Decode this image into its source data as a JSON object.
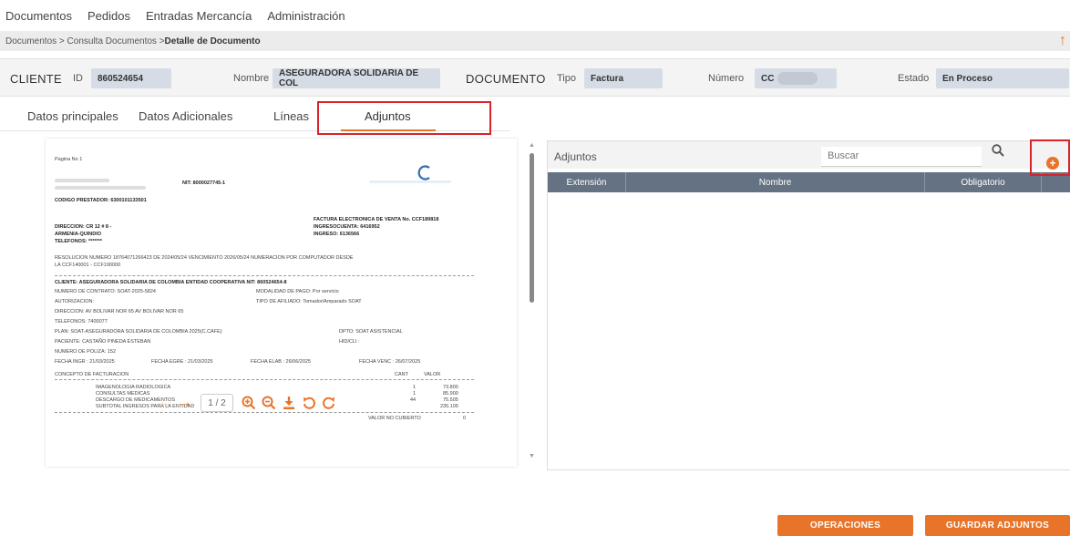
{
  "topnav": {
    "items": [
      "Documentos",
      "Pedidos",
      "Entradas Mercancía",
      "Administración"
    ]
  },
  "breadcrumb": {
    "trail": "Documentos > Consulta Documentos > ",
    "current": "Detalle de Documento"
  },
  "header": {
    "cliente_label": "CLIENTE",
    "id_label": "ID",
    "id_value": "860524654",
    "nombre_label": "Nombre",
    "nombre_value": "ASEGURADORA SOLIDARIA DE COL",
    "documento_label": "DOCUMENTO",
    "tipo_label": "Tipo",
    "tipo_value": "Factura",
    "numero_label": "Número",
    "numero_value": "CC",
    "estado_label": "Estado",
    "estado_value": "En Proceso"
  },
  "tabs": [
    "Datos principales",
    "Datos Adicionales",
    "Líneas",
    "Adjuntos"
  ],
  "active_tab": "Adjuntos",
  "document_preview": {
    "page_label": "Pagina No 1",
    "nit": "NIT: 8000027745-1",
    "codigo_prestador": "CODIGO PRESTADOR: 6300101133501",
    "factura": "FACTURA ELECTRONICA DE VENTA No. CCF189818",
    "ingreso_cuenta": "INGRESOCUENTA: 6416952",
    "ingreso": "INGRESO: 6136566",
    "direccion": "DIRECCION: CR 12 # 8 -",
    "ciudad": "ARMENIA-QUINDIO",
    "telefono": "TELEFONOS: *******",
    "resolucion": "RESOLUCION NUMERO 18764071266423 DE 2024/05/24 VENCIMIENTO 2026/05/24 NUMERACION POR COMPUTADOR DESDE",
    "rango": "LA CCF140001 - CCF190000",
    "cliente": "CLIENTE: ASEGURADORA SOLIDARIA DE COLOMBIA ENTIDAD COOPERATIVA NIT: 860524654-8",
    "contrato": "NUMERO DE CONTRATO: SOAT-2025-5824",
    "modalidad": "MODALIDAD DE PAGO: Por servicio",
    "autorizacion": "AUTORIZACION:",
    "tipo_afiliado": "TIPO DE AFILIADO: Tomador/Amparado SOAT",
    "direccion_cliente": "DIRECCION: AV BOLIVAR NOR 65 AV BOLIVAR NOR 65",
    "telefonos_cliente": "TELEFONOS: 7400077",
    "plan": "PLAN: SOAT-ASEGURADORA SOLIDARIA DE COLOMBIA 2025(C.CAFE)",
    "dpto": "DPTO: SOAT ASISTENCIAL",
    "paciente": "PACIENTE: CASTAÑO PINEDA ESTEBAN",
    "hid": "HID/CLI :",
    "poliza": "NUMERO DE POLIZA: 152",
    "fecha_ingr": "FECHA INGR : 21/03/2025",
    "fecha_egre": "FECHA EGRE : 21/03/2025",
    "fecha_elab": "FECHA ELAB : 26/06/2025",
    "fecha_venc": "FECHA VENC : 26/07/2025",
    "concepto_header": "CONCEPTO DE FACTURACION",
    "cant_header": "CANT",
    "valor_header": "VALOR",
    "lines": [
      {
        "concepto": "IMAGENOLOGIA RADIOLOGICA",
        "cant": "1",
        "valor": "73.800"
      },
      {
        "concepto": "CONSULTAS MEDICAS",
        "cant": "1",
        "valor": "85.900"
      },
      {
        "concepto": "DESCARGO DE MEDICAMENTOS",
        "cant": "44",
        "valor": "75.505"
      },
      {
        "concepto": "SUBTOTAL INGRESOS PARA LA ENTIDAD",
        "cant": "",
        "valor": "235.105"
      }
    ],
    "valor_no_cubierto_label": "VALOR NO CUBIERTO",
    "valor_no_cubierto": "0"
  },
  "pager": {
    "page_indicator": "1 / 2"
  },
  "adjuntos": {
    "title": "Adjuntos",
    "search_placeholder": "Buscar",
    "columns": [
      "Extensión",
      "Nombre",
      "Obligatorio"
    ]
  },
  "buttons": {
    "operaciones": "OPERACIONES",
    "guardar": "GUARDAR ADJUNTOS"
  },
  "colors": {
    "accent": "#e8742a",
    "highlight_border": "#d9232a",
    "table_header": "#647283"
  },
  "icons": [
    "arrow-up-icon",
    "arrow-left-icon",
    "arrow-right-icon",
    "zoom-in-icon",
    "zoom-out-icon",
    "download-icon",
    "rotate-left-icon",
    "rotate-right-icon",
    "search-icon",
    "add-circle-icon"
  ]
}
